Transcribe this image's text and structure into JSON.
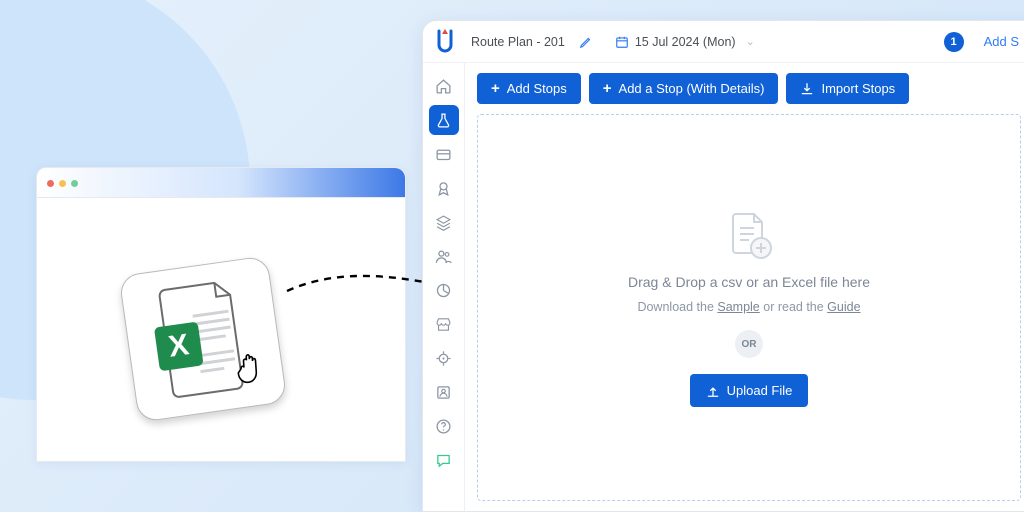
{
  "header": {
    "route_title": "Route Plan - 201",
    "date": "15 Jul 2024 (Mon)",
    "step_number": "1",
    "step_label": "Add S"
  },
  "sidebar": {
    "items": [
      {
        "icon": "home"
      },
      {
        "icon": "flask",
        "active": true
      },
      {
        "icon": "card"
      },
      {
        "icon": "badge"
      },
      {
        "icon": "layers"
      },
      {
        "icon": "users"
      },
      {
        "icon": "pie"
      },
      {
        "icon": "store"
      },
      {
        "icon": "target"
      },
      {
        "icon": "id"
      },
      {
        "icon": "help"
      },
      {
        "icon": "chat"
      }
    ]
  },
  "action_bar": {
    "add_stops": "Add Stops",
    "add_stop_details": "Add a Stop (With Details)",
    "import_stops": "Import Stops"
  },
  "dropzone": {
    "title": "Drag & Drop a csv or an Excel file here",
    "download_prefix": "Download the ",
    "sample_link": "Sample",
    "middle": " or read the ",
    "guide_link": "Guide",
    "or": "OR",
    "upload": "Upload File"
  }
}
